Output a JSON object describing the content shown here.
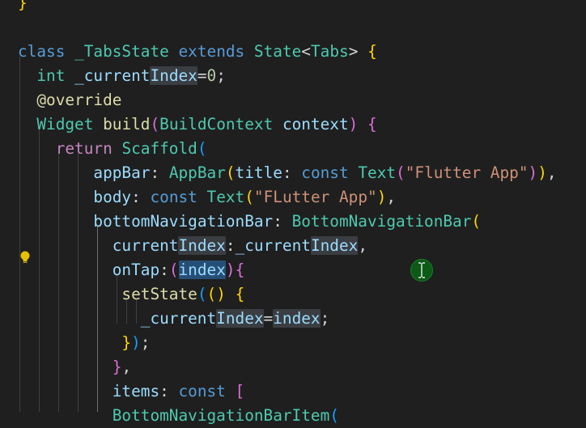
{
  "colors": {
    "background": "#1f1f1f",
    "keyword_blue": "#569cd6",
    "keyword_purple": "#c586c0",
    "type_teal": "#4ec9b0",
    "function_yellow": "#dcdcaa",
    "variable_lightblue": "#9cdcfe",
    "string_orange": "#ce9178",
    "number_green": "#b5cea8",
    "bracket_gold": "#ffd700",
    "bracket_pink": "#da70d6",
    "bracket_blue": "#179fff",
    "decorator": "#dcdcaa",
    "punctuation": "#d4d4d4"
  },
  "icons": {
    "lightbulb": "lightbulb-icon",
    "text_cursor": "text-cursor-icon"
  },
  "lines": [
    {
      "tokens": [
        {
          "t": "}",
          "c": "bracket_gold"
        }
      ]
    },
    {
      "tokens": []
    },
    {
      "tokens": [
        {
          "t": "class",
          "c": "keyword_blue"
        },
        {
          "t": " "
        },
        {
          "t": "_TabsState",
          "c": "type_teal"
        },
        {
          "t": " "
        },
        {
          "t": "extends",
          "c": "keyword_blue"
        },
        {
          "t": " "
        },
        {
          "t": "State",
          "c": "type_teal"
        },
        {
          "t": "<",
          "c": "punctuation"
        },
        {
          "t": "Tabs",
          "c": "type_teal"
        },
        {
          "t": ">",
          "c": "punctuation"
        },
        {
          "t": " "
        },
        {
          "t": "{",
          "c": "bracket_gold"
        }
      ]
    },
    {
      "tokens": [
        {
          "t": "  "
        },
        {
          "t": "int",
          "c": "type_teal"
        },
        {
          "t": " "
        },
        {
          "t": "_current",
          "c": "variable_lightblue"
        },
        {
          "t": "Index",
          "c": "variable_lightblue",
          "hl": "occ"
        },
        {
          "t": "=",
          "c": "punctuation"
        },
        {
          "t": "0",
          "c": "number_green"
        },
        {
          "t": ";",
          "c": "punctuation"
        }
      ]
    },
    {
      "tokens": [
        {
          "t": "  "
        },
        {
          "t": "@override",
          "c": "decorator"
        }
      ]
    },
    {
      "tokens": [
        {
          "t": "  "
        },
        {
          "t": "Widget",
          "c": "type_teal"
        },
        {
          "t": " "
        },
        {
          "t": "build",
          "c": "function_yellow"
        },
        {
          "t": "(",
          "c": "bracket_pink"
        },
        {
          "t": "BuildContext",
          "c": "type_teal"
        },
        {
          "t": " "
        },
        {
          "t": "context",
          "c": "variable_lightblue"
        },
        {
          "t": ")",
          "c": "bracket_pink"
        },
        {
          "t": " "
        },
        {
          "t": "{",
          "c": "bracket_pink"
        }
      ]
    },
    {
      "tokens": [
        {
          "t": "    "
        },
        {
          "t": "return",
          "c": "keyword_purple"
        },
        {
          "t": " "
        },
        {
          "t": "Scaffold",
          "c": "type_teal"
        },
        {
          "t": "(",
          "c": "bracket_blue"
        }
      ]
    },
    {
      "tokens": [
        {
          "t": "        "
        },
        {
          "t": "appBar",
          "c": "variable_lightblue"
        },
        {
          "t": ": ",
          "c": "punctuation"
        },
        {
          "t": "AppBar",
          "c": "type_teal"
        },
        {
          "t": "(",
          "c": "bracket_gold"
        },
        {
          "t": "title",
          "c": "variable_lightblue"
        },
        {
          "t": ": ",
          "c": "punctuation"
        },
        {
          "t": "const",
          "c": "keyword_blue"
        },
        {
          "t": " "
        },
        {
          "t": "Text",
          "c": "type_teal"
        },
        {
          "t": "(",
          "c": "bracket_pink"
        },
        {
          "t": "\"Flutter App\"",
          "c": "string_orange"
        },
        {
          "t": ")",
          "c": "bracket_pink"
        },
        {
          "t": ")",
          "c": "bracket_gold"
        },
        {
          "t": ",",
          "c": "punctuation"
        }
      ]
    },
    {
      "tokens": [
        {
          "t": "        "
        },
        {
          "t": "body",
          "c": "variable_lightblue"
        },
        {
          "t": ": ",
          "c": "punctuation"
        },
        {
          "t": "const",
          "c": "keyword_blue"
        },
        {
          "t": " "
        },
        {
          "t": "Text",
          "c": "type_teal"
        },
        {
          "t": "(",
          "c": "bracket_gold"
        },
        {
          "t": "\"FLutter App\"",
          "c": "string_orange"
        },
        {
          "t": ")",
          "c": "bracket_gold"
        },
        {
          "t": ",",
          "c": "punctuation"
        }
      ]
    },
    {
      "tokens": [
        {
          "t": "        "
        },
        {
          "t": "bottomNavigationBar",
          "c": "variable_lightblue"
        },
        {
          "t": ": ",
          "c": "punctuation"
        },
        {
          "t": "BottomNavigationBar",
          "c": "type_teal"
        },
        {
          "t": "(",
          "c": "bracket_gold"
        }
      ]
    },
    {
      "tokens": [
        {
          "t": "          "
        },
        {
          "t": "current",
          "c": "variable_lightblue"
        },
        {
          "t": "Index",
          "c": "variable_lightblue",
          "hl": "occ"
        },
        {
          "t": ":",
          "c": "punctuation"
        },
        {
          "t": "_current",
          "c": "variable_lightblue"
        },
        {
          "t": "Index",
          "c": "variable_lightblue",
          "hl": "occ"
        },
        {
          "t": ",",
          "c": "punctuation"
        }
      ]
    },
    {
      "tokens": [
        {
          "t": "          "
        },
        {
          "t": "onTap",
          "c": "variable_lightblue"
        },
        {
          "t": ":",
          "c": "punctuation"
        },
        {
          "t": "(",
          "c": "bracket_pink"
        },
        {
          "t": "index",
          "c": "variable_lightblue",
          "hl": "sel"
        },
        {
          "t": ")",
          "c": "bracket_pink"
        },
        {
          "t": "{",
          "c": "bracket_pink"
        }
      ]
    },
    {
      "tokens": [
        {
          "t": "           "
        },
        {
          "t": "setState",
          "c": "function_yellow"
        },
        {
          "t": "(",
          "c": "bracket_blue"
        },
        {
          "t": "()",
          "c": "bracket_gold"
        },
        {
          "t": " "
        },
        {
          "t": "{",
          "c": "bracket_gold"
        }
      ]
    },
    {
      "tokens": [
        {
          "t": "             "
        },
        {
          "t": "_current",
          "c": "variable_lightblue"
        },
        {
          "t": "Index",
          "c": "variable_lightblue",
          "hl": "occ"
        },
        {
          "t": "=",
          "c": "punctuation"
        },
        {
          "t": "index",
          "c": "variable_lightblue",
          "hl": "occ"
        },
        {
          "t": ";",
          "c": "punctuation"
        }
      ]
    },
    {
      "tokens": [
        {
          "t": "           "
        },
        {
          "t": "}",
          "c": "bracket_gold"
        },
        {
          "t": ")",
          "c": "bracket_blue"
        },
        {
          "t": ";",
          "c": "punctuation"
        }
      ]
    },
    {
      "tokens": [
        {
          "t": "          "
        },
        {
          "t": "}",
          "c": "bracket_pink"
        },
        {
          "t": ",",
          "c": "punctuation"
        }
      ]
    },
    {
      "tokens": [
        {
          "t": "          "
        },
        {
          "t": "items",
          "c": "variable_lightblue"
        },
        {
          "t": ": ",
          "c": "punctuation"
        },
        {
          "t": "const",
          "c": "keyword_blue"
        },
        {
          "t": " "
        },
        {
          "t": "[",
          "c": "bracket_pink"
        }
      ]
    },
    {
      "tokens": [
        {
          "t": "          "
        },
        {
          "t": "BottomNavigationBarItem",
          "c": "type_teal"
        },
        {
          "t": "(",
          "c": "bracket_blue"
        }
      ]
    }
  ]
}
